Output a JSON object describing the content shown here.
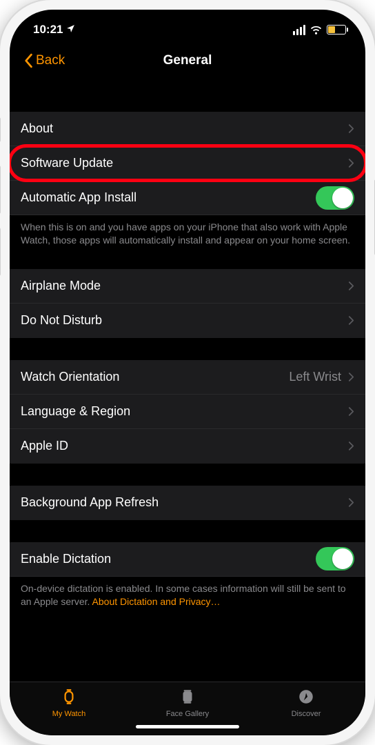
{
  "status": {
    "time": "10:21"
  },
  "nav": {
    "back": "Back",
    "title": "General"
  },
  "rows": {
    "about": "About",
    "software_update": "Software Update",
    "auto_install": "Automatic App Install",
    "airplane": "Airplane Mode",
    "dnd": "Do Not Disturb",
    "orientation_label": "Watch Orientation",
    "orientation_value": "Left Wrist",
    "lang": "Language & Region",
    "apple_id": "Apple ID",
    "background_refresh": "Background App Refresh",
    "dictation": "Enable Dictation"
  },
  "footers": {
    "auto_install": "When this is on and you have apps on your iPhone that also work with Apple Watch, those apps will automatically install and appear on your home screen.",
    "dictation_pre": "On-device dictation is enabled. In some cases information will still be sent to an Apple server. ",
    "dictation_link": "About Dictation and Privacy…"
  },
  "tabs": {
    "my_watch": "My Watch",
    "face_gallery": "Face Gallery",
    "discover": "Discover"
  }
}
